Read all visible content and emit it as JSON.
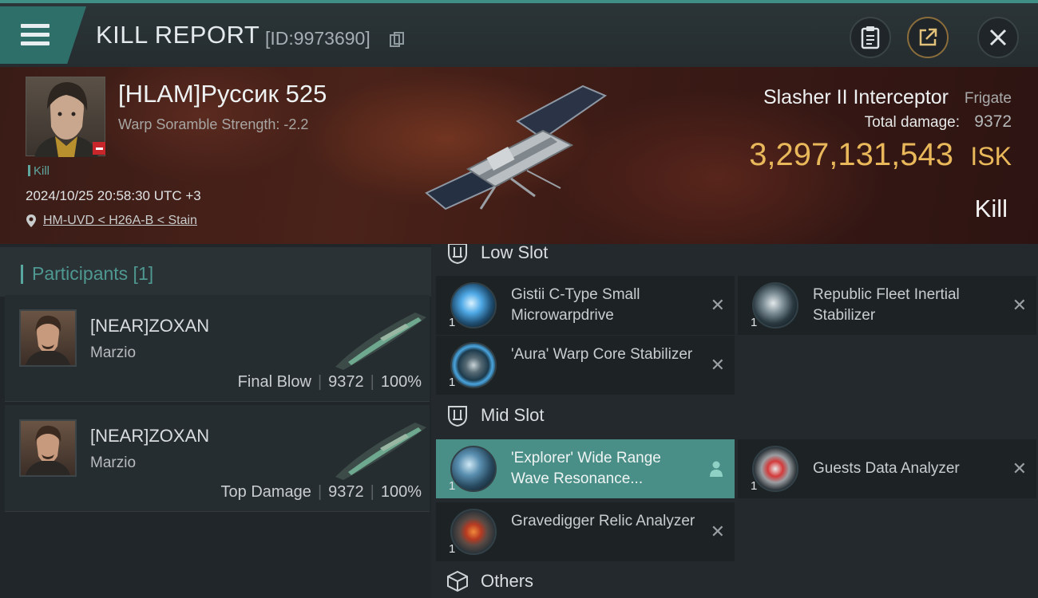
{
  "header": {
    "title": "KILL REPORT",
    "id_text": "[ID:9973690]",
    "icons": {
      "menu": "menu-icon",
      "copy": "copy-icon",
      "clipboard": "clipboard-icon",
      "share": "share-icon",
      "close": "close-icon"
    }
  },
  "victim": {
    "name": "[HLAM]Руссик 525",
    "scramble": "Warp Soramble Strength: -2.2",
    "tag": "Kill",
    "datetime": "2024/10/25 20:58:30 UTC +3",
    "location": "HM-UVD < H26A-B < Stain"
  },
  "ship": {
    "name": "Slasher II Interceptor",
    "class": "Frigate",
    "total_damage_label": "Total damage:",
    "total_damage_value": "9372",
    "isk_value": "3,297,131,543",
    "isk_unit": "ISK",
    "result": "Kill"
  },
  "participants": {
    "title": "Participants [1]",
    "rows": [
      {
        "name": "[NEAR]ZOXAN",
        "sub": "Marzio",
        "role": "Final Blow",
        "damage": "9372",
        "percent": "100%"
      },
      {
        "name": "[NEAR]ZOXAN",
        "sub": "Marzio",
        "role": "Top Damage",
        "damage": "9372",
        "percent": "100%"
      }
    ]
  },
  "fittings": {
    "low_slot": {
      "title": "Low Slot",
      "modules": [
        {
          "name": "Gistii C-Type Small Microwarpdrive",
          "qty": "1"
        },
        {
          "name": "Republic Fleet Inertial Stabilizer",
          "qty": "1"
        },
        {
          "name": "'Aura' Warp Core Stabilizer",
          "qty": "1"
        }
      ]
    },
    "mid_slot": {
      "title": "Mid Slot",
      "modules": [
        {
          "name": "'Explorer' Wide Range Wave Resonance...",
          "qty": "1"
        },
        {
          "name": "Guests Data Analyzer",
          "qty": "1"
        },
        {
          "name": "Gravedigger Relic Analyzer",
          "qty": "1"
        }
      ]
    },
    "others": {
      "title": "Others"
    }
  },
  "colors": {
    "accent": "#4a8f87",
    "isk": "#e9b85a",
    "participants_title": "#4f9891"
  }
}
